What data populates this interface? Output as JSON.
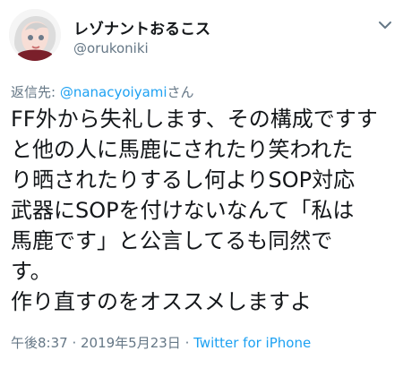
{
  "user": {
    "display_name": "レゾナントおるこス",
    "handle": "@orukoniki",
    "avatar_icon": "user-avatar-icon"
  },
  "menu": {
    "icon": "chevron-down-icon"
  },
  "reply": {
    "prefix": "返信先: ",
    "mention": "@nanacyoiyami",
    "suffix": "さん"
  },
  "tweet": {
    "lines": [
      "FF外から失礼します、その構成ですす",
      "と他の人に馬鹿にされたり笑われた",
      "り晒されたりするし何よりSOP対応",
      "武器にSOPを付けないなんて「私は",
      "馬鹿です」と公言してるも同然で",
      "す。",
      "作り直すのをオススメしますよ"
    ]
  },
  "meta": {
    "time": "午後8:37",
    "sep1": " · ",
    "date": "2019年5月23日",
    "sep2": " · ",
    "client": "Twitter for iPhone"
  },
  "colors": {
    "link": "#1da1f2",
    "secondary": "#657786",
    "text": "#14171a"
  }
}
